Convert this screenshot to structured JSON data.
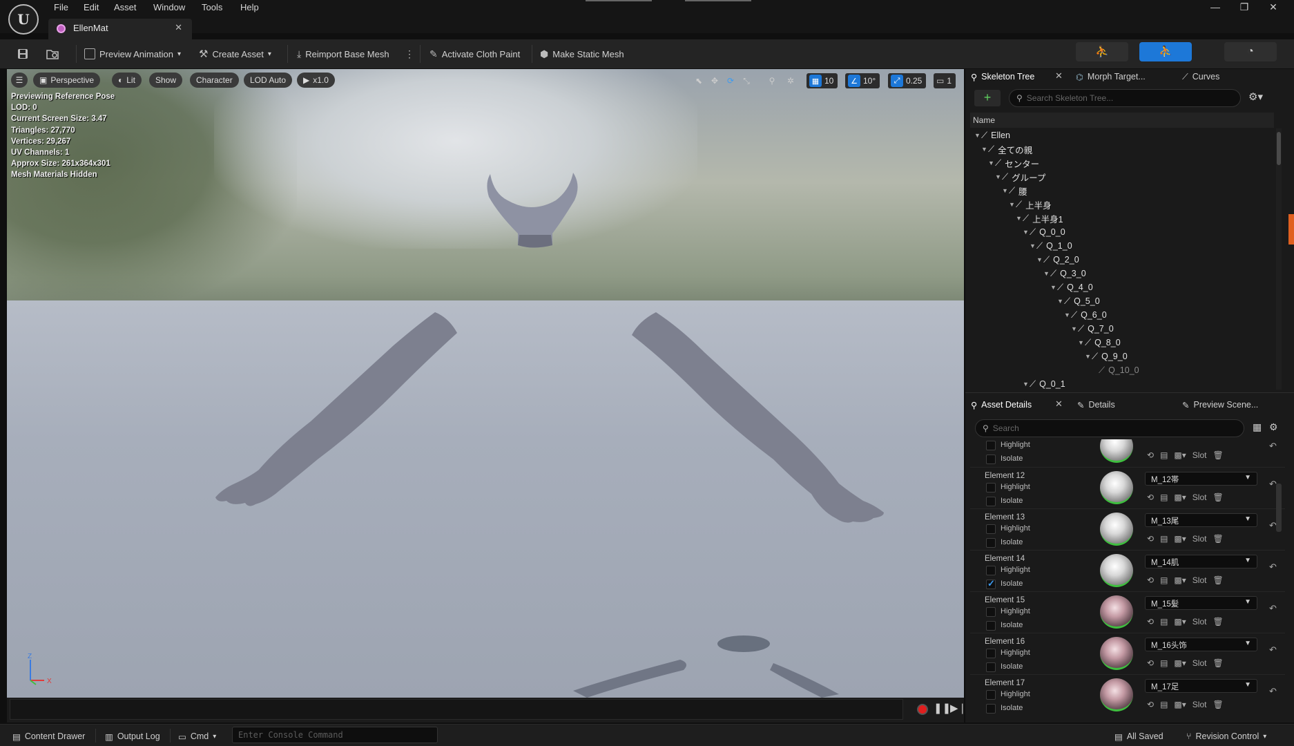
{
  "menu": {
    "items": [
      "File",
      "Edit",
      "Asset",
      "Window",
      "Tools",
      "Help"
    ]
  },
  "document_tab": {
    "label": "EllenMat"
  },
  "toolbar": {
    "preview_animation": "Preview Animation",
    "create_asset": "Create Asset",
    "reimport_base_mesh": "Reimport Base Mesh",
    "activate_cloth_paint": "Activate Cloth Paint",
    "make_static_mesh": "Make Static Mesh"
  },
  "viewport": {
    "toolbar": {
      "perspective": "Perspective",
      "lit": "Lit",
      "show": "Show",
      "character": "Character",
      "lod": "LOD Auto",
      "play_rate": "x1.0",
      "grid_snap": "10",
      "rotation_snap": "10°",
      "scale_snap": "0.25",
      "camera_speed": "1"
    },
    "stats": [
      "Previewing Reference Pose",
      "LOD: 0",
      "Current Screen Size: 3.47",
      "Triangles: 27,770",
      "Vertices: 29,267",
      "UV Channels: 1",
      "Approx Size: 261x364x301",
      "Mesh Materials Hidden"
    ],
    "axis": {
      "z": "Z",
      "x": "X"
    }
  },
  "skeleton_panel": {
    "tabs": [
      "Skeleton Tree",
      "Morph Target...",
      "Curves"
    ],
    "search_placeholder": "Search Skeleton Tree...",
    "column_name": "Name",
    "bones": [
      {
        "name": "Ellen",
        "depth": 0,
        "expanded": true
      },
      {
        "name": "全ての親",
        "depth": 1,
        "expanded": true
      },
      {
        "name": "センター",
        "depth": 2,
        "expanded": true
      },
      {
        "name": "グループ",
        "depth": 3,
        "expanded": true
      },
      {
        "name": "腰",
        "depth": 4,
        "expanded": true
      },
      {
        "name": "上半身",
        "depth": 5,
        "expanded": true
      },
      {
        "name": "上半身1",
        "depth": 6,
        "expanded": true
      },
      {
        "name": "Q_0_0",
        "depth": 7,
        "expanded": true
      },
      {
        "name": "Q_1_0",
        "depth": 8,
        "expanded": true
      },
      {
        "name": "Q_2_0",
        "depth": 9,
        "expanded": true
      },
      {
        "name": "Q_3_0",
        "depth": 10,
        "expanded": true
      },
      {
        "name": "Q_4_0",
        "depth": 11,
        "expanded": true
      },
      {
        "name": "Q_5_0",
        "depth": 12,
        "expanded": true
      },
      {
        "name": "Q_6_0",
        "depth": 13,
        "expanded": true
      },
      {
        "name": "Q_7_0",
        "depth": 14,
        "expanded": true
      },
      {
        "name": "Q_8_0",
        "depth": 15,
        "expanded": true
      },
      {
        "name": "Q_9_0",
        "depth": 16,
        "expanded": true
      },
      {
        "name": "Q_10_0",
        "depth": 17,
        "expanded": false,
        "dim": true
      },
      {
        "name": "Q_0_1",
        "depth": 7,
        "expanded": true
      }
    ]
  },
  "details_panel": {
    "tabs": [
      "Asset Details",
      "Details",
      "Preview Scene..."
    ],
    "search_placeholder": "Search",
    "highlight_label": "Highlight",
    "isolate_label": "Isolate",
    "slot_label": "Slot",
    "partial_element": {
      "highlight": false,
      "isolate": false
    },
    "elements": [
      {
        "name": "Element 12",
        "material": "M_12帯",
        "highlight": false,
        "isolate": false,
        "thumb": "white"
      },
      {
        "name": "Element 13",
        "material": "M_13尾",
        "highlight": false,
        "isolate": false,
        "thumb": "white"
      },
      {
        "name": "Element 14",
        "material": "M_14肌",
        "highlight": false,
        "isolate": true,
        "thumb": "white"
      },
      {
        "name": "Element 15",
        "material": "M_15髪",
        "highlight": false,
        "isolate": false,
        "thumb": "pink"
      },
      {
        "name": "Element 16",
        "material": "M_16头饰",
        "highlight": false,
        "isolate": false,
        "thumb": "pink"
      },
      {
        "name": "Element 17",
        "material": "M_17足",
        "highlight": false,
        "isolate": false,
        "thumb": "pink"
      }
    ]
  },
  "statusbar": {
    "content_drawer": "Content Drawer",
    "output_log": "Output Log",
    "cmd": "Cmd",
    "console_placeholder": "Enter Console Command",
    "all_saved": "All Saved",
    "revision_control": "Revision Control"
  },
  "colors": {
    "accent_blue": "#1d78d8",
    "record_red": "#e01e1e",
    "thumb_green": "#3fbf3f"
  }
}
